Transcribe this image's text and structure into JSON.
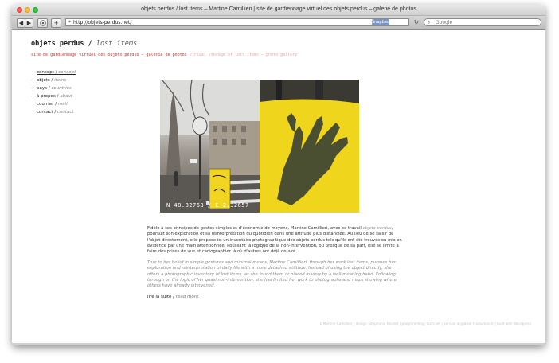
{
  "window": {
    "title": "objets perdus / lost items – Martine Camillieri | site de gardiennage virtuel des objets perdus – galerie de photos"
  },
  "toolbar": {
    "back_label": "◀",
    "forward_label": "▶",
    "add_label": "+",
    "url": "http://objets-perdus.net/",
    "snapback_label": "Snapback",
    "search_placeholder": "Google"
  },
  "site": {
    "title_fr": "objets perdus /",
    "title_en": "lost items",
    "subtitle_fr": "site de gardiennage virtuel des objets perdus – galerie de photos",
    "subtitle_en": "virtual storage of lost items – photo gallery"
  },
  "nav": {
    "items": [
      {
        "fr": "concept /",
        "en": "concept",
        "plus": ""
      },
      {
        "fr": "objets /",
        "en": "items",
        "plus": "+"
      },
      {
        "fr": "pays /",
        "en": "countries",
        "plus": "+"
      },
      {
        "fr": "à propos /",
        "en": "about",
        "plus": "+"
      },
      {
        "fr": "courrier /",
        "en": "mail",
        "plus": ""
      },
      {
        "fr": "contact /",
        "en": "contact",
        "plus": ""
      }
    ]
  },
  "photo": {
    "coords": "N 48.82768 / E 2.32657"
  },
  "text": {
    "fr_1": "Fidèle à ses principes de gestes simples et d'économie de moyens, Martine Camillieri, avec ce travail",
    "fr_link": "objets perdus",
    "fr_2": ", poursuit son exploration et sa réinterprétation du quotidien dans une attitude plus distanciée. Au lieu de se saisir de l'objet directement, elle propose ici un inventaire photographique des objets perdus tels qu'ils ont été trouvés ou mis en évidence par une main attentionnée. Poussant la logique de la non-intervention, ou presque de sa part, elle se limite à faire des prises de vue et cartographier là où d'autres ont déjà oeuvré.",
    "en": "True to her belief in simple gestures and minimal means, Martine Camillieri, through her work lost items, pursues her exploration and reinterpretation of daily life with a more detached attitude. Instead of using the object directly, she offers a photographic inventory of lost items, as she found them or placed in view by a well-meaning hand. Following through on the logic of her quasi non-intervention, she has limited her work to photographs and maps showing where others have already intervened.",
    "readmore_fr": "lire la suite /",
    "readmore_en": "read more"
  },
  "footer": {
    "text": "©Martine Camillieri | design: Stéphanie Nicolet | programming: toctl.net | version anglaise: traduction.fr | built with Wordpress"
  },
  "colors": {
    "accent_red": "#d8281f",
    "accent_pink": "#f0a6a0",
    "glove_yellow": "#f0d51d"
  }
}
